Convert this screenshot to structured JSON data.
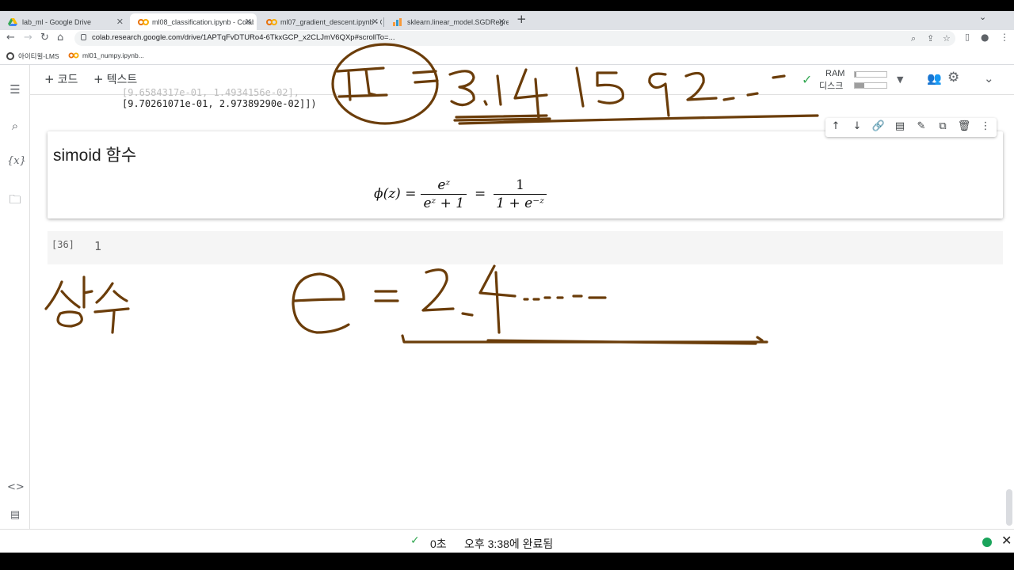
{
  "browser": {
    "tabs": [
      {
        "title": "lab_ml - Google Drive",
        "icon": "google-drive-icon",
        "active": false
      },
      {
        "title": "ml08_classification.ipynb - Colab",
        "icon": "colab-icon",
        "active": true
      },
      {
        "title": "ml07_gradient_descent.ipynb - C",
        "icon": "colab-icon",
        "active": false
      },
      {
        "title": "sklearn.linear_model.SGDRegre",
        "icon": "sklearn-icon",
        "active": false
      }
    ],
    "url": "colab.research.google.com/drive/1APTqFvDTURo4-6TkxGCP_x2CLJmV6QXp#scrollTo=...",
    "bookmarks": [
      {
        "label": "아이티윌-LMS",
        "icon": "globe-icon"
      },
      {
        "label": "ml01_numpy.ipynb...",
        "icon": "colab-icon"
      }
    ]
  },
  "colab": {
    "toolbar": {
      "add_code": "코드",
      "add_text": "텍스트",
      "ram_label": "RAM",
      "disk_label": "디스크",
      "ram_usage": 0.05,
      "disk_usage": 0.3
    },
    "output_lines": {
      "clipped": "[9.6584317e-01, 1.4934156e-02],",
      "last": "[9.70261071e-01, 2.97389290e-02]])"
    },
    "markdown_cell": {
      "title": "simoid 함수"
    },
    "formula": {
      "lhs": "ϕ(z) =",
      "frac1_num": "eᶻ",
      "frac1_den": "eᶻ + 1",
      "eq": "=",
      "frac2_num": "1",
      "frac2_den": "1 + e⁻ᶻ"
    },
    "code_cell": {
      "exec_count": "[36]",
      "code": "1"
    },
    "status": {
      "duration": "0초",
      "completed": "오후 3:38에 완료됨"
    }
  },
  "colors": {
    "ink": "#6b3d0a",
    "check_green": "#34a853",
    "status_dot": "#1aa45b"
  }
}
